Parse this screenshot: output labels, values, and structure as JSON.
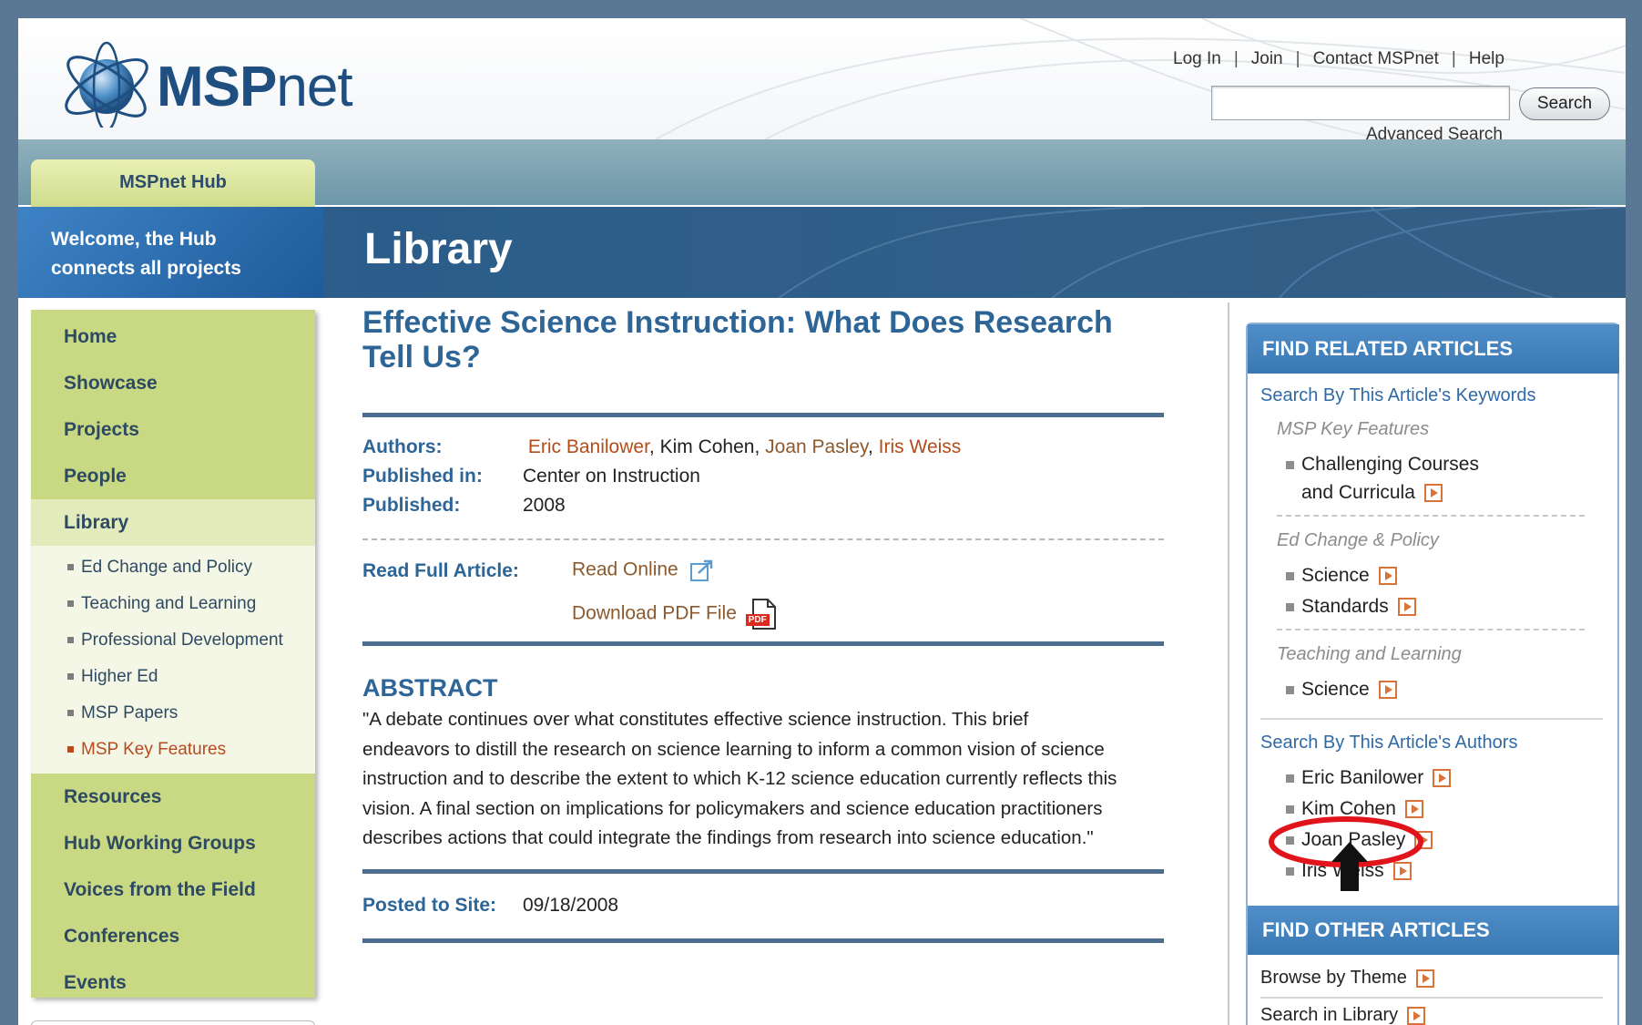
{
  "header": {
    "logo_bold": "MSP",
    "logo_light": "net",
    "links": [
      "Log In",
      "Join",
      "Contact MSPnet",
      "Help"
    ],
    "separator": "|",
    "search_button": "Search",
    "search_value": "",
    "advanced_search": "Advanced Search"
  },
  "hub_tab": "MSPnet Hub",
  "banner": {
    "welcome_line1": "Welcome, the Hub",
    "welcome_line2": "connects all projects",
    "title": "Library"
  },
  "leftnav": {
    "top_items": [
      "Home",
      "Showcase",
      "Projects",
      "People"
    ],
    "active_item": "Library",
    "sub_items": [
      "Ed Change and Policy",
      "Teaching and Learning",
      "Professional Development",
      "Higher Ed",
      "MSP Papers",
      "MSP Key Features"
    ],
    "active_sub_item": "MSP Key Features",
    "bottom_items": [
      "Resources",
      "Hub Working Groups",
      "Voices from the Field",
      "Conferences",
      "Events"
    ]
  },
  "article": {
    "title_line1": "Effective Science Instruction: What Does Research",
    "title_line2": "Tell Us?",
    "authors_label": "Authors:",
    "authors": [
      {
        "name": "Eric Banilower",
        "sep": ", "
      },
      {
        "name": "Kim Cohen",
        "sep": ", "
      },
      {
        "name": "Joan Pasley",
        "sep": ", "
      },
      {
        "name": "Iris Weiss",
        "sep": ""
      }
    ],
    "published_in_label": "Published in:",
    "published_in": "Center on Instruction",
    "published_label": "Published:",
    "published": "2008",
    "read_full_label": "Read Full Article:",
    "read_online": "Read Online",
    "download_pdf": "Download PDF File",
    "pdf_badge": "PDF",
    "abstract_heading": "ABSTRACT",
    "abstract_lines": [
      "\"A debate continues over what constitutes effective science instruction. This brief",
      "endeavors to distill the research on science learning to inform a common vision of science",
      "instruction and to describe the extent to which K-12 science education currently reflects this",
      "vision. A final section on implications for policymakers and science education practitioners",
      "describes actions that could integrate the findings from research into science education.\""
    ],
    "posted_label": "Posted to Site:",
    "posted_date": "09/18/2008"
  },
  "sidebar": {
    "related_heading": "FIND RELATED ARTICLES",
    "keywords_link": "Search By This Article's Keywords",
    "cat1": "MSP Key Features",
    "cat1_item_line1": "Challenging Courses",
    "cat1_item_line2": "and Curricula",
    "cat2": "Ed Change & Policy",
    "cat2_items": [
      "Science",
      "Standards"
    ],
    "cat3": "Teaching and Learning",
    "cat3_items": [
      "Science"
    ],
    "authors_link": "Search By This Article's Authors",
    "author_items": [
      "Eric Banilower",
      "Kim Cohen",
      "Joan Pasley",
      "Iris Weiss"
    ],
    "other_heading": "FIND OTHER ARTICLES",
    "other_links": [
      "Browse by Theme",
      "Search in Library"
    ]
  },
  "colors": {
    "brand_blue": "#1f4f80",
    "link_orange": "#b44c1a",
    "nav_green": "#c9d883",
    "highlight_red": "#e0141a"
  }
}
